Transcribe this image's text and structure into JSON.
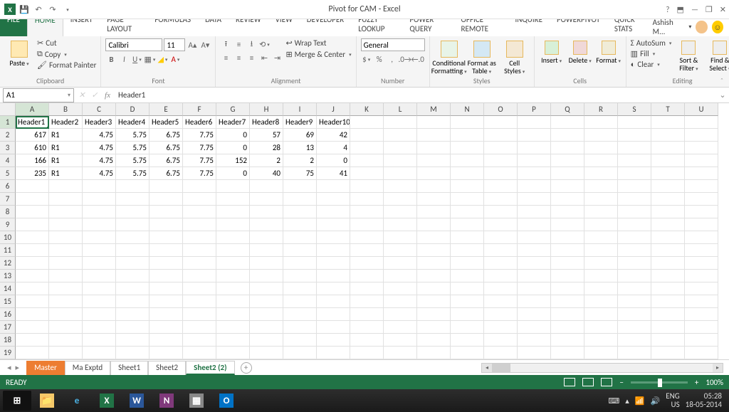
{
  "title": "Pivot for CAM - Excel",
  "user": {
    "name": "Ashish M..."
  },
  "tabs": [
    "FILE",
    "HOME",
    "INSERT",
    "PAGE LAYOUT",
    "FORMULAS",
    "DATA",
    "REVIEW",
    "VIEW",
    "DEVELOPER",
    "Fuzzy Lookup",
    "POWER QUERY",
    "OFFICE REMOTE",
    "INQUIRE",
    "POWERPIVOT",
    "QUICK STATS"
  ],
  "active_tab": "HOME",
  "ribbon": {
    "clipboard": {
      "paste": "Paste",
      "cut": "Cut",
      "copy": "Copy",
      "fp": "Format Painter",
      "label": "Clipboard"
    },
    "font": {
      "name": "Calibri",
      "size": "11",
      "label": "Font"
    },
    "alignment": {
      "wrap": "Wrap Text",
      "merge": "Merge & Center",
      "label": "Alignment"
    },
    "number": {
      "format": "General",
      "label": "Number"
    },
    "styles": {
      "cond": "Conditional Formatting",
      "table": "Format as Table",
      "cell": "Cell Styles",
      "label": "Styles"
    },
    "cells": {
      "insert": "Insert",
      "delete": "Delete",
      "format": "Format",
      "label": "Cells"
    },
    "editing": {
      "autosum": "AutoSum",
      "fill": "Fill",
      "clear": "Clear",
      "sort": "Sort & Filter",
      "find": "Find & Select",
      "label": "Editing"
    }
  },
  "namebox": "A1",
  "formula": "Header1",
  "columns": [
    "A",
    "B",
    "C",
    "D",
    "E",
    "F",
    "G",
    "H",
    "I",
    "J",
    "K",
    "L",
    "M",
    "N",
    "O",
    "P",
    "Q",
    "R",
    "S",
    "T",
    "U"
  ],
  "rowcount": 23,
  "active_cell": {
    "r": 1,
    "c": 0
  },
  "data": [
    [
      "Header1",
      "Header2",
      "Header3",
      "Header4",
      "Header5",
      "Header6",
      "Header7",
      "Header8",
      "Header9",
      "Header10"
    ],
    [
      "617",
      "R1",
      "4.75",
      "5.75",
      "6.75",
      "7.75",
      "0",
      "57",
      "69",
      "42"
    ],
    [
      "610",
      "R1",
      "4.75",
      "5.75",
      "6.75",
      "7.75",
      "0",
      "28",
      "13",
      "4"
    ],
    [
      "166",
      "R1",
      "4.75",
      "5.75",
      "6.75",
      "7.75",
      "152",
      "2",
      "2",
      "0"
    ],
    [
      "235",
      "R1",
      "4.75",
      "5.75",
      "6.75",
      "7.75",
      "0",
      "40",
      "75",
      "41"
    ]
  ],
  "sheets": [
    "Master",
    "Ma Exptd",
    "Sheet1",
    "Sheet2",
    "Sheet2 (2)"
  ],
  "active_sheet": "Sheet2 (2)",
  "status": "READY",
  "zoom": "100%",
  "tray": {
    "lang": "ENG",
    "region": "US",
    "time": "05:28",
    "date": "18-05-2014"
  }
}
